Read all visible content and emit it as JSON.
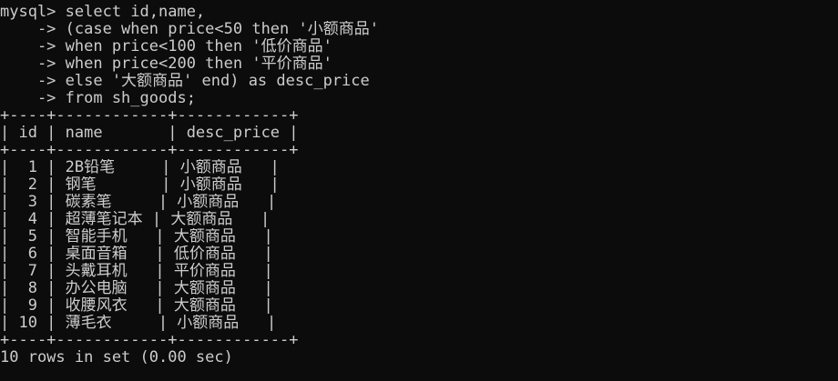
{
  "terminal": {
    "lines": [
      "mysql> select id,name,",
      "    -> (case when price<50 then '小额商品'",
      "    -> when price<100 then '低价商品'",
      "    -> when price<200 then '平价商品'",
      "    -> else '大额商品' end) as desc_price",
      "    -> from sh_goods;",
      "+----+------------+------------+",
      "| id | name       | desc_price |",
      "+----+------------+------------+",
      "|  1 | 2B铅笔     | 小额商品   |",
      "|  2 | 钢笔       | 小额商品   |",
      "|  3 | 碳素笔     | 小额商品   |",
      "|  4 | 超薄笔记本 | 大额商品   |",
      "|  5 | 智能手机   | 大额商品   |",
      "|  6 | 桌面音箱   | 低价商品   |",
      "|  7 | 头戴耳机   | 平价商品   |",
      "|  8 | 办公电脑   | 大额商品   |",
      "|  9 | 收腰风衣   | 大额商品   |",
      "| 10 | 薄毛衣     | 小额商品   |",
      "+----+------------+------------+",
      "10 rows in set (0.00 sec)"
    ]
  },
  "colors": {
    "background": "#0c0c0c",
    "text": "#cccccc"
  }
}
